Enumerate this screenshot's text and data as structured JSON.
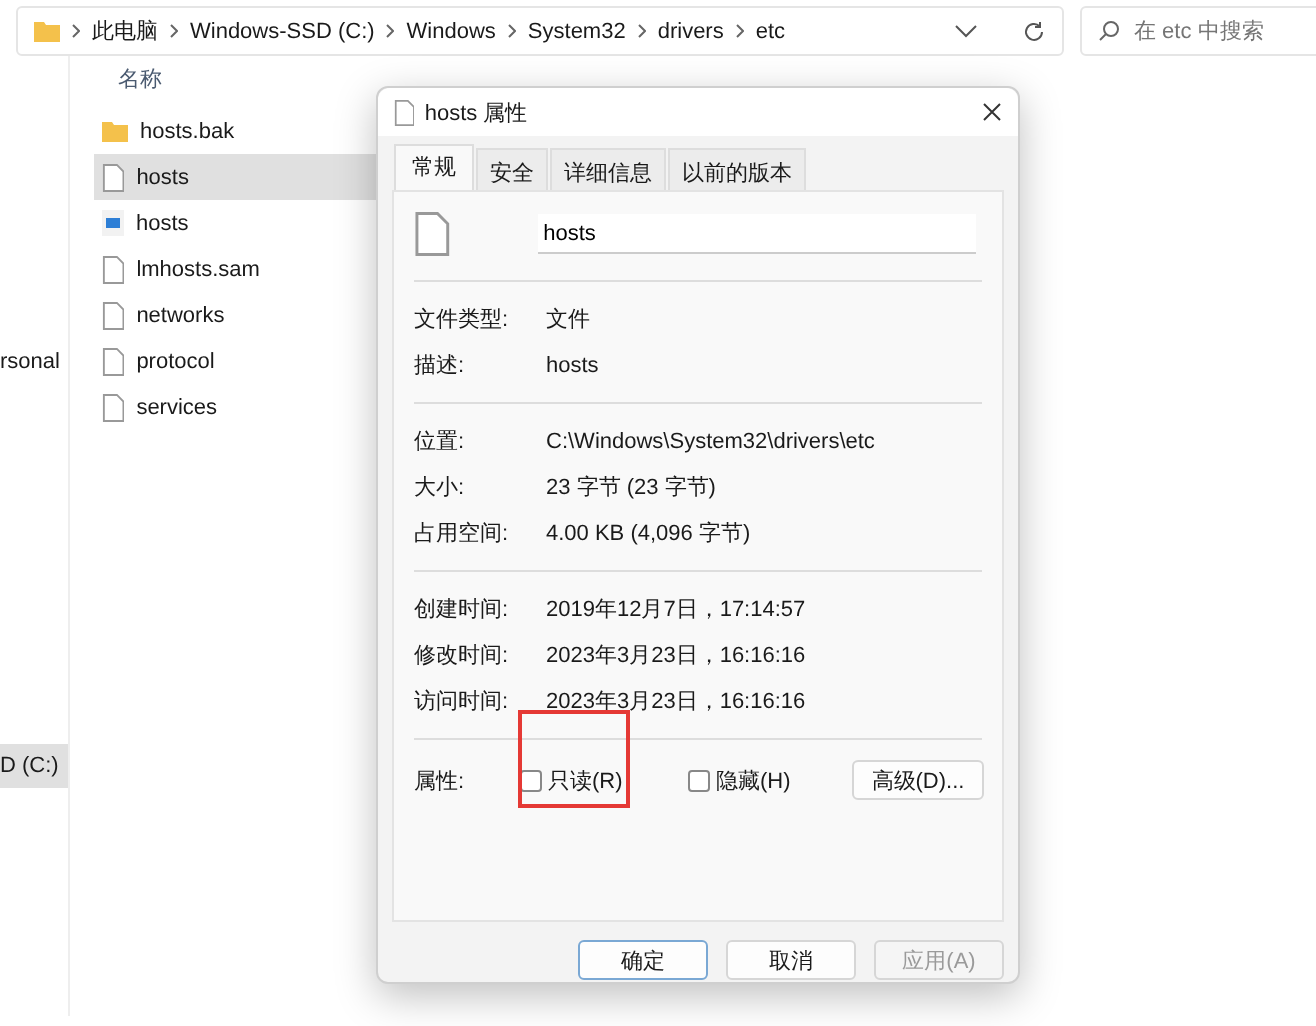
{
  "address_bar": {
    "path": [
      "此电脑",
      "Windows-SSD (C:)",
      "Windows",
      "System32",
      "drivers",
      "etc"
    ]
  },
  "search": {
    "placeholder": "在 etc 中搜索"
  },
  "sidebar": {
    "items": [
      {
        "label": "rsonal",
        "selected": false
      },
      {
        "label": "D (C:)",
        "selected": true
      }
    ]
  },
  "file_list": {
    "columns": [
      "名称"
    ],
    "files": [
      {
        "name": "hosts.bak",
        "kind": "folder",
        "selected": false
      },
      {
        "name": "hosts",
        "kind": "document",
        "selected": true
      },
      {
        "name": "hosts",
        "kind": "script",
        "selected": false
      },
      {
        "name": "lmhosts.sam",
        "kind": "document",
        "selected": false
      },
      {
        "name": "networks",
        "kind": "document",
        "selected": false
      },
      {
        "name": "protocol",
        "kind": "document",
        "selected": false
      },
      {
        "name": "services",
        "kind": "document",
        "selected": false
      }
    ]
  },
  "dialog": {
    "title": "hosts 属性",
    "tabs": [
      {
        "label": "常规",
        "selected": true
      },
      {
        "label": "安全",
        "selected": false
      },
      {
        "label": "详细信息",
        "selected": false
      },
      {
        "label": "以前的版本",
        "selected": false
      }
    ],
    "file_name": "hosts",
    "groups": [
      [
        {
          "label": "文件类型:",
          "value": "文件"
        },
        {
          "label": "描述:",
          "value": "hosts"
        }
      ],
      [
        {
          "label": "位置:",
          "value": "C:\\Windows\\System32\\drivers\\etc"
        },
        {
          "label": "大小:",
          "value": "23 字节 (23 字节)"
        },
        {
          "label": "占用空间:",
          "value": "4.00 KB (4,096 字节)"
        }
      ],
      [
        {
          "label": "创建时间:",
          "value": "2019年12月7日，17:14:57"
        },
        {
          "label": "修改时间:",
          "value": "2023年3月23日，16:16:16"
        },
        {
          "label": "访问时间:",
          "value": "2023年3月23日，16:16:16"
        }
      ]
    ],
    "attributes": {
      "label": "属性:",
      "options": [
        {
          "label": "只读(R)",
          "checked": false,
          "highlighted": true
        },
        {
          "label": "隐藏(H)",
          "checked": false,
          "highlighted": false
        }
      ],
      "advanced_button": "高级(D)..."
    },
    "buttons": [
      {
        "label": "确定",
        "kind": "default",
        "disabled": false
      },
      {
        "label": "取消",
        "kind": "normal",
        "disabled": false
      },
      {
        "label": "应用(A)",
        "kind": "normal",
        "disabled": true
      }
    ]
  }
}
